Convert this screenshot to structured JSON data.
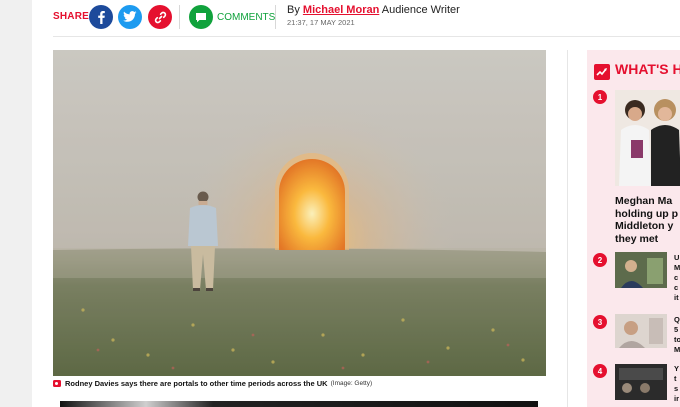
{
  "share_bar": {
    "share_label": "SHARE",
    "facebook_icon": "facebook-icon",
    "twitter_icon": "twitter-icon",
    "link_icon": "link-icon",
    "comments_icon": "comment-icon",
    "comments_label": "COMMENTS",
    "byline_prefix": "By ",
    "author": "Michael Moran",
    "author_role": " Audience Writer",
    "datetime": "21:37, 17 MAY 2021"
  },
  "hero": {
    "caption": "Rodney Davies says there are portals to other time periods across the UK",
    "credit": "(Image: Getty)"
  },
  "sidebar": {
    "title": "WHAT'S H",
    "items": [
      {
        "rank": "1",
        "title_lines": [
          "Meghan Ma",
          "holding up p",
          "Middleton y",
          "they met"
        ]
      },
      {
        "rank": "2",
        "title_lines": [
          "U",
          "M",
          "c",
          "c",
          "it"
        ]
      },
      {
        "rank": "3",
        "title_lines": [
          "Q",
          "5",
          "to",
          "M"
        ]
      },
      {
        "rank": "4",
        "title_lines": [
          "Y",
          "t",
          "s",
          "ir"
        ]
      }
    ]
  },
  "colors": {
    "brand_red": "#e5102f",
    "facebook": "#1d4a9b",
    "twitter": "#1d9bf0",
    "comments_green": "#10a23c",
    "sidebar_bg": "#fbe8ec"
  }
}
